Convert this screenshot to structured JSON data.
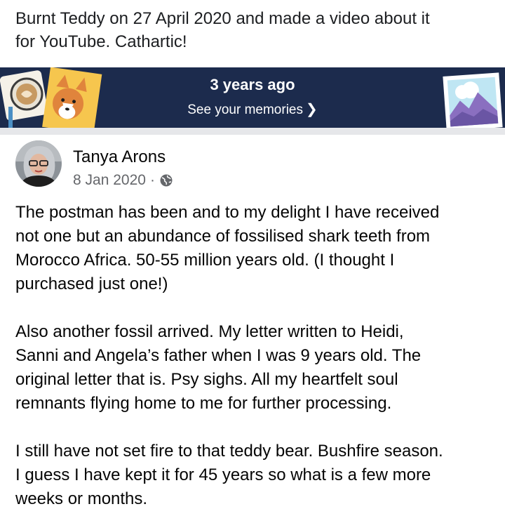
{
  "caption": {
    "lines": [
      "Burnt Teddy on 27 April 2020 and made a video about it",
      "for YouTube.  Cathartic!"
    ]
  },
  "memories": {
    "title": "3 years ago",
    "link_label": "See your memories",
    "link_chevron": "❯",
    "colors": {
      "background": "#1c2b4d"
    },
    "icons": [
      "coffee-cup-icon",
      "corgi-dog-photo-icon",
      "mountain-photo-icon"
    ]
  },
  "post": {
    "author": "Tanya Arons",
    "date": "8 Jan 2020",
    "separator": "·",
    "privacy_icon": "globe-icon",
    "paragraphs": [
      [
        "The postman has been and to my delight I have received",
        "not one but an abundance of fossilised shark teeth from",
        "Morocco Africa.  50-55 million years old. (I thought I",
        "purchased just one!)"
      ],
      [
        "Also another fossil arrived.  My letter written to Heidi,",
        "Sanni and Angela’s father when I was 9 years old.  The",
        "original letter that is.  Psy sighs.  All my heartfelt soul",
        "remnants flying home to me for further processing."
      ],
      [
        "I still have not set fire to that teddy bear.  Bushfire season.",
        "I guess I have kept it for 45 years so what is a few more",
        "weeks or months."
      ]
    ]
  }
}
